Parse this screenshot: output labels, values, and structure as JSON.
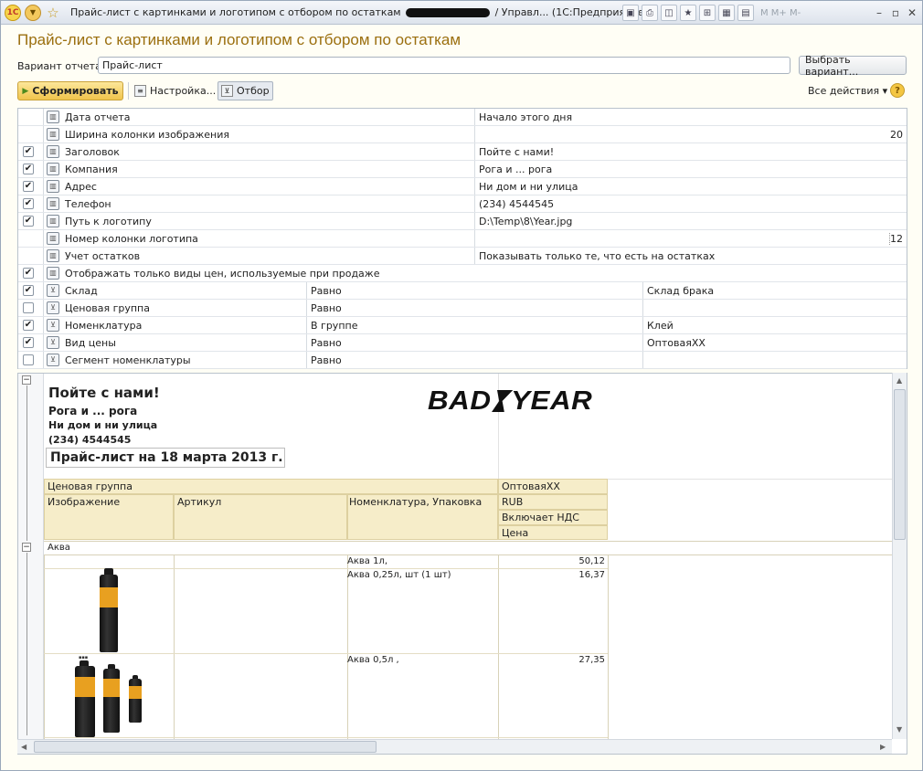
{
  "window": {
    "title_before": "Прайс-лист с картинками и логотипом с отбором по остаткам",
    "title_after": "/ Управл...  (1С:Предприятие)",
    "tool_m": "M  M+  M-"
  },
  "header": {
    "title": "Прайс-лист с картинками и логотипом с отбором по остаткам",
    "variant_label": "Вариант отчета:",
    "variant_value": "Прайс-лист",
    "choose_variant": "Выбрать вариант..."
  },
  "toolbar": {
    "generate": "Сформировать",
    "settings": "Настройка...",
    "filter": "Отбор",
    "all_actions": "Все действия ▾",
    "help": "?"
  },
  "params": [
    {
      "checkbox": "none",
      "name": "Дата отчета",
      "value": "Начало этого дня"
    },
    {
      "checkbox": "none",
      "name": "Ширина колонки изображения",
      "value": "20"
    },
    {
      "checkbox": "checked",
      "name": "Заголовок",
      "value": "Пойте с нами!"
    },
    {
      "checkbox": "checked",
      "name": "Компания",
      "value": "Рога и ... рога"
    },
    {
      "checkbox": "checked",
      "name": "Адрес",
      "value": "Ни дом и ни улица"
    },
    {
      "checkbox": "checked",
      "name": "Телефон",
      "value": "(234) 4544545"
    },
    {
      "checkbox": "checked",
      "name": "Путь к логотипу",
      "value": "D:\\Temp\\8\\Year.jpg"
    },
    {
      "checkbox": "none",
      "name": "Номер колонки логотипа",
      "value": "12"
    },
    {
      "checkbox": "none",
      "name": "Учет остатков",
      "value": "Показывать только те, что есть на остатках"
    },
    {
      "checkbox": "checked",
      "name": "Отображать только виды цен, используемые при продаже",
      "value": ""
    }
  ],
  "filters": [
    {
      "checked": true,
      "field": "Склад",
      "condition": "Равно",
      "value": "Склад брака"
    },
    {
      "checked": false,
      "field": "Ценовая группа",
      "condition": "Равно",
      "value": ""
    },
    {
      "checked": true,
      "field": "Номенклатура",
      "condition": "В группе",
      "value": "Клей"
    },
    {
      "checked": true,
      "field": "Вид цены",
      "condition": "Равно",
      "value": "ОптоваяХХ"
    },
    {
      "checked": false,
      "field": "Сегмент номенклатуры",
      "condition": "Равно",
      "value": ""
    }
  ],
  "report": {
    "heading": "Пойте с нами!",
    "company": "Рога и ... рога",
    "address": "Ни дом и ни улица",
    "phone": "(234) 4544545",
    "pricelist_title": "Прайс-лист на 18 марта 2013 г.",
    "logo_left": "BAD",
    "logo_right": "YEAR",
    "col_price_group": "Ценовая группа",
    "col_image": "Изображение",
    "col_article": "Артикул",
    "col_nomenclature": "Номенклатура, Упаковка",
    "price_type": "ОптоваяХХ",
    "currency": "RUB",
    "vat": "Включает НДС",
    "price_label": "Цена",
    "group_name": "Аква",
    "rows": [
      {
        "name": "Аква 1л,",
        "price": "50,12"
      },
      {
        "name": "Аква 0,25л, шт (1 шт)",
        "price": "16,37"
      },
      {
        "name": "Аква 0,5л ,",
        "price": "27,35"
      }
    ]
  },
  "colors": {
    "title": "#9b6f0f",
    "report_header_bg": "#f6edc9",
    "accent_button": "#f0c44c"
  }
}
